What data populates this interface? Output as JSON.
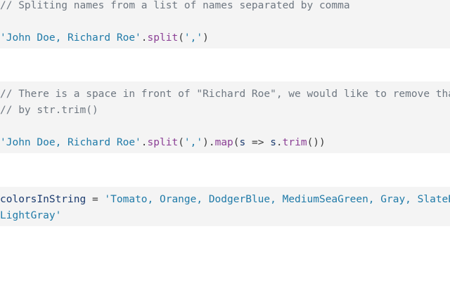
{
  "code_blocks": [
    {
      "lines": [
        [
          {
            "t": "comment",
            "v": "// Spliting names from a list of names separated by comma"
          }
        ],
        [],
        [
          {
            "t": "str",
            "v": "'John Doe, Richard Roe'"
          },
          {
            "t": "plain",
            "v": "."
          },
          {
            "t": "fn",
            "v": "split"
          },
          {
            "t": "plain",
            "v": "("
          },
          {
            "t": "str",
            "v": "','"
          },
          {
            "t": "plain",
            "v": ")"
          }
        ]
      ]
    },
    {
      "lines": [
        [
          {
            "t": "comment",
            "v": "// There is a space in front of \"Richard Roe\", we would like to remove that"
          }
        ],
        [
          {
            "t": "comment",
            "v": "// by str.trim()"
          }
        ],
        [],
        [
          {
            "t": "str",
            "v": "'John Doe, Richard Roe'"
          },
          {
            "t": "plain",
            "v": "."
          },
          {
            "t": "fn",
            "v": "split"
          },
          {
            "t": "plain",
            "v": "("
          },
          {
            "t": "str",
            "v": "','"
          },
          {
            "t": "plain",
            "v": ")."
          },
          {
            "t": "fn",
            "v": "map"
          },
          {
            "t": "plain",
            "v": "("
          },
          {
            "t": "ident",
            "v": "s"
          },
          {
            "t": "plain",
            "v": " => "
          },
          {
            "t": "ident",
            "v": "s"
          },
          {
            "t": "plain",
            "v": "."
          },
          {
            "t": "fn",
            "v": "trim"
          },
          {
            "t": "plain",
            "v": "())"
          }
        ]
      ]
    },
    {
      "lines": [
        [
          {
            "t": "ident",
            "v": "colorsInString"
          },
          {
            "t": "plain",
            "v": " = "
          },
          {
            "t": "str",
            "v": "'Tomato, Orange, DodgerBlue, MediumSeaGreen, Gray, SlateBlue, Violet,"
          }
        ],
        [
          {
            "t": "str",
            "v": "LightGray'"
          }
        ]
      ]
    }
  ]
}
